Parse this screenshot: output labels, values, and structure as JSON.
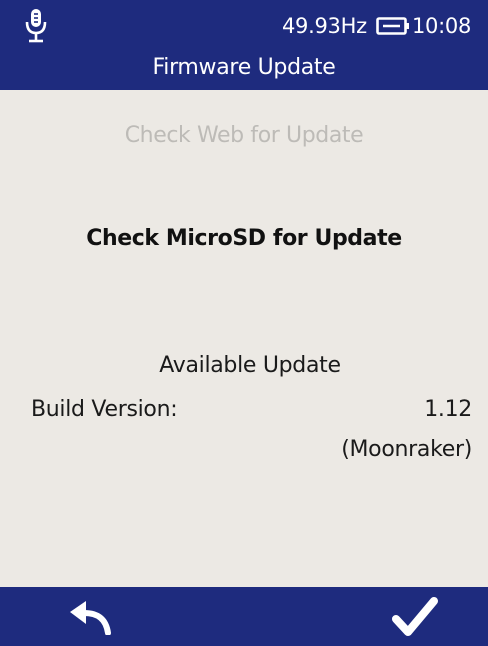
{
  "status_bar": {
    "frequency": "49.93Hz",
    "time": "10:08",
    "mic_icon": "microphone-icon",
    "battery_icon": "battery-icon"
  },
  "header": {
    "title": "Firmware Update"
  },
  "menu": {
    "web_update": "Check Web for Update",
    "sd_update": "Check MicroSD for Update"
  },
  "update_info": {
    "heading": "Available Update",
    "build_label": "Build Version:",
    "build_version": "1.12",
    "build_name": "(Moonraker)"
  },
  "footer": {
    "back_icon": "back-arrow-icon",
    "confirm_icon": "checkmark-icon"
  },
  "colors": {
    "bar": "#1e2b7e",
    "background": "#ece9e4",
    "disabled_text": "#bdbbb7"
  }
}
